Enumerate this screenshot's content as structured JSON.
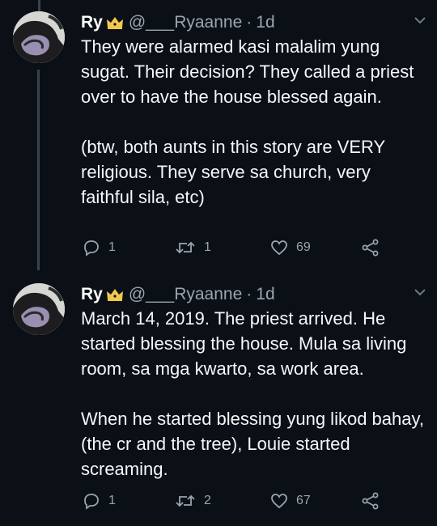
{
  "tweets": [
    {
      "display_name": "Ry",
      "handle": "@___Ryaanne",
      "separator": "·",
      "time": "1d",
      "text": "They were alarmed kasi malalim yung sugat. Their decision? They called a priest over to have the house blessed again.\n\n(btw, both aunts in this story are VERY religious. They serve sa church, very faithful sila, etc)",
      "reply_count": "1",
      "retweet_count": "1",
      "like_count": "69"
    },
    {
      "display_name": "Ry",
      "handle": "@___Ryaanne",
      "separator": "·",
      "time": "1d",
      "text": "March 14, 2019. The priest arrived. He started blessing the house. Mula sa living room, sa mga kwarto, sa work area.\n\nWhen he started blessing yung likod bahay, (the cr and the tree), Louie started screaming.",
      "reply_count": "1",
      "retweet_count": "2",
      "like_count": "67"
    }
  ],
  "icons": {
    "badge": "crown-icon",
    "menu": "chevron-down-icon",
    "reply": "reply-icon",
    "retweet": "retweet-icon",
    "like": "heart-icon",
    "share": "share-icon"
  },
  "colors": {
    "background": "#0b1017",
    "text": "#f5f7f9",
    "secondary": "#9aa5ad",
    "thread_line": "#38444d",
    "crown": "#f2c84b"
  }
}
